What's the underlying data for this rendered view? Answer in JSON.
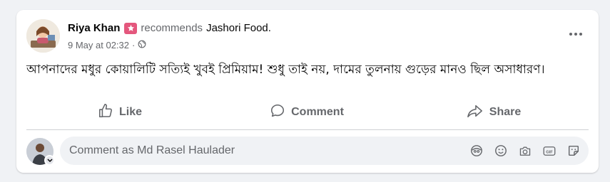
{
  "post": {
    "author": "Riya Khan",
    "recommends": "recommends",
    "page": "Jashori Food",
    "period": ".",
    "date": "9 May at 02:32",
    "separator": "·",
    "text": "আপনাদের মধুর কোয়ালিটি সত্যিই খুবই প্রিমিয়াম! শুধু তাই নয়, দামের তুলনায় গুড়ের মানও ছিল অসাধারণ।"
  },
  "actions": {
    "like": "Like",
    "comment": "Comment",
    "share": "Share"
  },
  "comment_box": {
    "placeholder": "Comment as Md Rasel Haulader"
  },
  "icons": {
    "badge": "star-badge-icon",
    "privacy": "globe-icon",
    "more": "more-options-icon",
    "like": "thumbs-up-icon",
    "comment": "speech-bubble-icon",
    "share": "share-arrow-icon",
    "avatar_sticker": "avatar-sticker-icon",
    "emoji": "emoji-icon",
    "camera": "camera-icon",
    "gif": "gif-icon",
    "sticker": "sticker-icon"
  },
  "colors": {
    "badge": "#e4577d",
    "secondary_text": "#65676b",
    "card_bg": "#ffffff",
    "page_bg": "#f0f2f5"
  }
}
